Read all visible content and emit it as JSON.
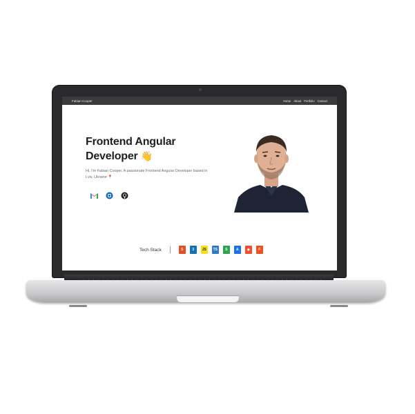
{
  "header": {
    "brand": "Fabian Cooper",
    "nav": [
      "Home",
      "About",
      "Portfolio",
      "Contact"
    ]
  },
  "hero": {
    "title_line1": "Frontend Angular",
    "title_line2": "Developer",
    "wave_emoji": "👋",
    "intro": "Hi, I'm Fabian Cooper. A passionate Frontend Angular Developer based in",
    "location": "Lviv, Ukraine",
    "pin_emoji": "📍"
  },
  "socials": [
    {
      "name": "gmail-icon",
      "color": "#ea4335"
    },
    {
      "name": "linkedin-icon",
      "color": "#0a66c2"
    },
    {
      "name": "github-icon",
      "color": "#1b1f23"
    }
  ],
  "tech_stack": {
    "label": "Tech Stack",
    "items": [
      {
        "name": "html5-icon",
        "glyph": "5",
        "color": "#e34f26"
      },
      {
        "name": "css3-icon",
        "glyph": "3",
        "color": "#1572b6"
      },
      {
        "name": "javascript-icon",
        "glyph": "JS",
        "color": "#f7df1e"
      },
      {
        "name": "typescript-icon",
        "glyph": "TS",
        "color": "#3178c6"
      },
      {
        "name": "sass-icon",
        "glyph": "S",
        "color": "#2ea44f"
      },
      {
        "name": "angular-icon",
        "glyph": "A",
        "color": "#1e72e8"
      },
      {
        "name": "git-icon",
        "glyph": "◆",
        "color": "#f05032"
      },
      {
        "name": "figma-icon",
        "glyph": "F",
        "color": "#f24e1e"
      }
    ]
  }
}
